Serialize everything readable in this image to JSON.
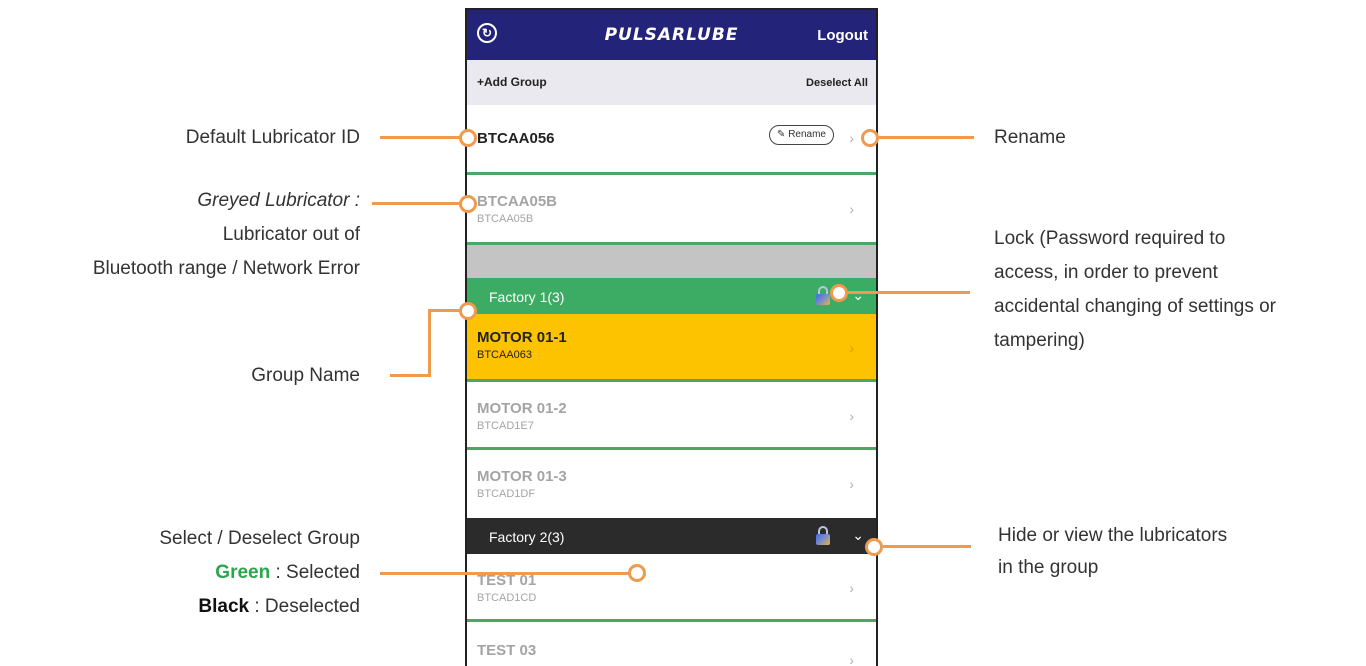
{
  "app": {
    "logo_text": "PULSARLUBE",
    "logout_label": "Logout",
    "add_group_label": "+Add Group",
    "deselect_all_label": "Deselect All"
  },
  "lubricators": [
    {
      "title": "BTCAA056",
      "rename_label": "Rename"
    },
    {
      "title": "BTCAA05B",
      "subtitle": "BTCAA05B"
    }
  ],
  "groups": [
    {
      "name": "Factory 1(3)",
      "state": "selected",
      "items": [
        {
          "title": "MOTOR 01-1",
          "subtitle": "BTCAA063"
        },
        {
          "title": "MOTOR 01-2",
          "subtitle": "BTCAD1E7"
        },
        {
          "title": "MOTOR 01-3",
          "subtitle": "BTCAD1DF"
        }
      ]
    },
    {
      "name": "Factory 2(3)",
      "state": "deselected",
      "items": [
        {
          "title": "TEST 01",
          "subtitle": "BTCAD1CD"
        },
        {
          "title": "TEST 03",
          "subtitle": ""
        }
      ]
    }
  ],
  "annotations": {
    "default_id": "Default Lubricator ID",
    "greyed_title": "Greyed Lubricator :",
    "greyed_line1": "Lubricator out of",
    "greyed_line2": "Bluetooth range / Network Error",
    "group_name": "Group Name",
    "select_line1": "Select / Deselect Group",
    "select_green_word": "Green",
    "select_green_rest": " : Selected",
    "select_black_word": "Black",
    "select_black_rest": " : Deselected",
    "rename": "Rename",
    "lock_line1": "Lock (Password required to",
    "lock_line2": "access, in order to prevent",
    "lock_line3": "accidental changing of settings or",
    "lock_line4": "tampering)",
    "hide_line1": "Hide or view the lubricators",
    "hide_line2": "in the group"
  },
  "colors": {
    "topbar": "#23237a",
    "selected_group": "#3cab64",
    "deselected_group": "#2b2b2b",
    "highlight_row": "#fec300",
    "annotation_line": "#ef9a4e"
  }
}
